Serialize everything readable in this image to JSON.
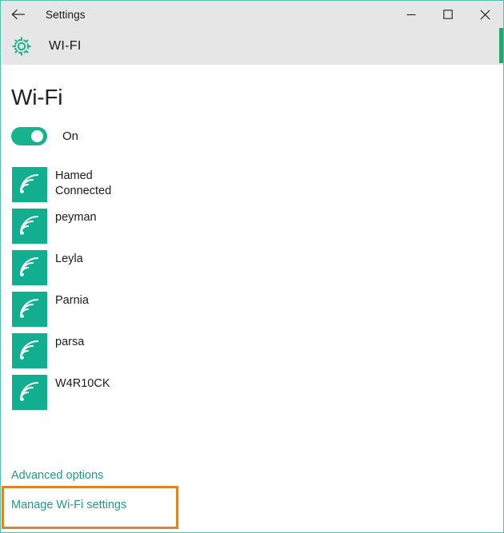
{
  "window": {
    "app_title": "Settings",
    "back_icon": "back-arrow-icon",
    "controls": {
      "minimize": "minimize-icon",
      "maximize": "maximize-icon",
      "close": "close-icon"
    },
    "border_color": "#4fc3b0"
  },
  "header": {
    "icon": "gear-icon",
    "title": "WI-FI",
    "background": "#e6e6e6",
    "scrollbar_color": "#2aa46f"
  },
  "page": {
    "title": "Wi-Fi",
    "toggle": {
      "state_label": "On",
      "checked": true,
      "on_color": "#17b28e",
      "icon": "toggle-switch"
    }
  },
  "networks": [
    {
      "name": "Hamed",
      "status": "Connected",
      "icon": "wifi-signal-icon",
      "icon_color": "#12ae90"
    },
    {
      "name": "peyman",
      "status": "",
      "icon": "wifi-signal-icon",
      "icon_color": "#12ae90"
    },
    {
      "name": "Leyla",
      "status": "",
      "icon": "wifi-signal-icon",
      "icon_color": "#12ae90"
    },
    {
      "name": "Parnia",
      "status": "",
      "icon": "wifi-signal-icon",
      "icon_color": "#12ae90"
    },
    {
      "name": "parsa",
      "status": "",
      "icon": "wifi-signal-icon",
      "icon_color": "#12ae90"
    },
    {
      "name": "W4R10CK",
      "status": "",
      "icon": "wifi-signal-icon",
      "icon_color": "#12ae90"
    }
  ],
  "links": {
    "advanced_options": "Advanced options",
    "manage_wifi_settings": "Manage Wi-Fi settings",
    "link_color": "#1f9b84",
    "highlight_color": "#e08527"
  }
}
